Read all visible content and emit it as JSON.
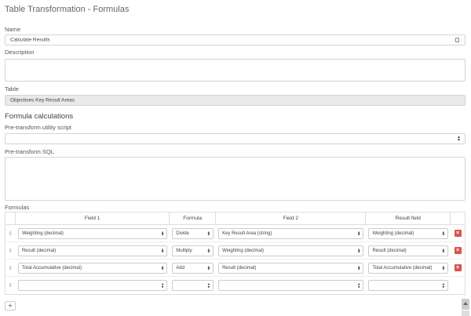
{
  "page": {
    "title": "Table Transformation - Formulas"
  },
  "name_field": {
    "label": "Name",
    "value": "Calculate Results"
  },
  "description_field": {
    "label": "Description",
    "value": ""
  },
  "table_field": {
    "label": "Table",
    "value": "Objectives Key Result Areas"
  },
  "formula_calculations": {
    "heading": "Formula calculations",
    "pre_transform_script": {
      "label": "Pre-transform utility script",
      "value": ""
    },
    "pre_transform_sql": {
      "label": "Pre-transform SQL",
      "value": ""
    }
  },
  "formulas": {
    "label": "Formulas",
    "columns": {
      "field1": "Field 1",
      "formula": "Formula",
      "field2": "Field 2",
      "result": "Result field"
    },
    "rows": [
      {
        "field1": "Weighting (decimal)",
        "formula": "Divide",
        "field2": "Key Result Area (string)",
        "result": "Weighting (decimal)"
      },
      {
        "field1": "Result (decimal)",
        "formula": "Multiply",
        "field2": "Weighting (decimal)",
        "result": "Result (decimal)"
      },
      {
        "field1": "Total Accumulative (decimal)",
        "formula": "Add",
        "field2": "Result (decimal)",
        "result": "Total Accumulative (decimal)"
      },
      {
        "field1": "",
        "formula": "",
        "field2": "",
        "result": ""
      }
    ],
    "add_label": "+",
    "delete_label": "×"
  }
}
